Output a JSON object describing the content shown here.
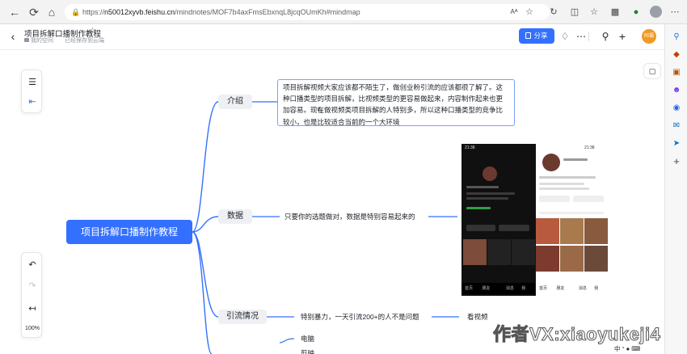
{
  "browser": {
    "url_prefix": "https://",
    "url_domain": "n50012xyvb.feishu.cn",
    "url_path": "/mindnotes/MOF7b4axFmsEbxnqL8jcqOUmKh#mindmap",
    "reader_label": "Aᴬ"
  },
  "header": {
    "title": "项目拆解口播制作教程",
    "space": "我的空间",
    "saved": "已经保存到云端",
    "share_label": "分享",
    "user_avatar_text": "阿福"
  },
  "toolbar": {
    "zoom": "100%"
  },
  "mindmap": {
    "root": "项目拆解口播制作教程",
    "topics": [
      {
        "label": "介绍"
      },
      {
        "label": "数据"
      },
      {
        "label": "引流情况"
      }
    ],
    "intro_text": "项目拆解视频大家应该都不陌生了，做创业粉引流的应该都很了解了。这种口播类型的项目拆解，比视频类型的更容易做起来，内容制作起来也更加容易。现在做视频类项目拆解的人特别多，所以这种口播类型的竞争比较小，也是比较适合当前的一个大环境",
    "data_text": "只要你的选题做对，数据是特别容易起来的",
    "traffic_text": "特别暴力，一天引流200+的人不是问题",
    "traffic_followup": "看视频",
    "sub_items": [
      "电脑",
      "剪映"
    ]
  },
  "phone_shot": {
    "status_left": "21:38",
    "status_right": "21:38",
    "nav_labels": [
      "首页",
      "朋友",
      "消息",
      "我"
    ]
  },
  "watermark": "作者VX:xiaoyukeji4",
  "tray": {
    "text": "中 ° "
  },
  "colors": {
    "accent": "#3370ff",
    "topic_bg": "#eef0f3",
    "link": "#3370ff",
    "avatar": "#f09a26"
  },
  "icons": [
    "back-icon",
    "forward-icon",
    "refresh-icon",
    "home-icon",
    "lock-icon",
    "star-icon",
    "share-icon",
    "bell-icon",
    "search-icon",
    "plus-icon",
    "outline-icon",
    "expand-icon",
    "undo-icon",
    "redo-icon",
    "collapse-icon",
    "comment-icon"
  ]
}
